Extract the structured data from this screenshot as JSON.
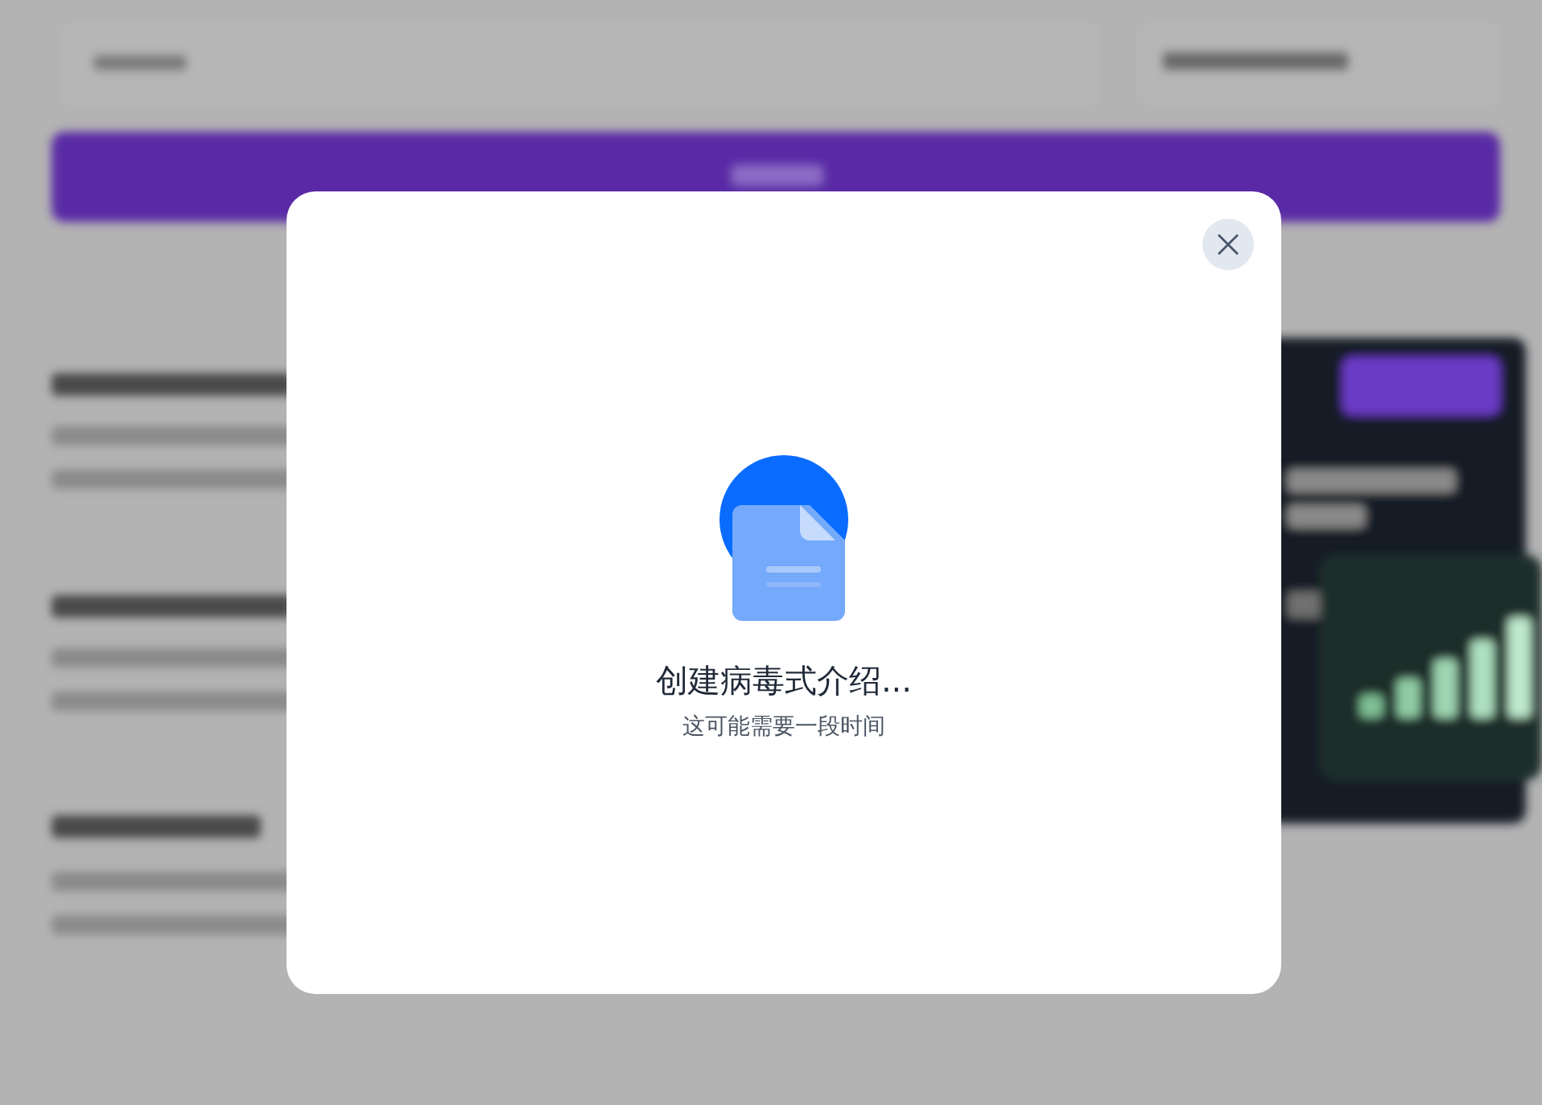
{
  "dialog": {
    "title": "创建病毒式介绍...",
    "subtitle": "这可能需要一段时间"
  }
}
